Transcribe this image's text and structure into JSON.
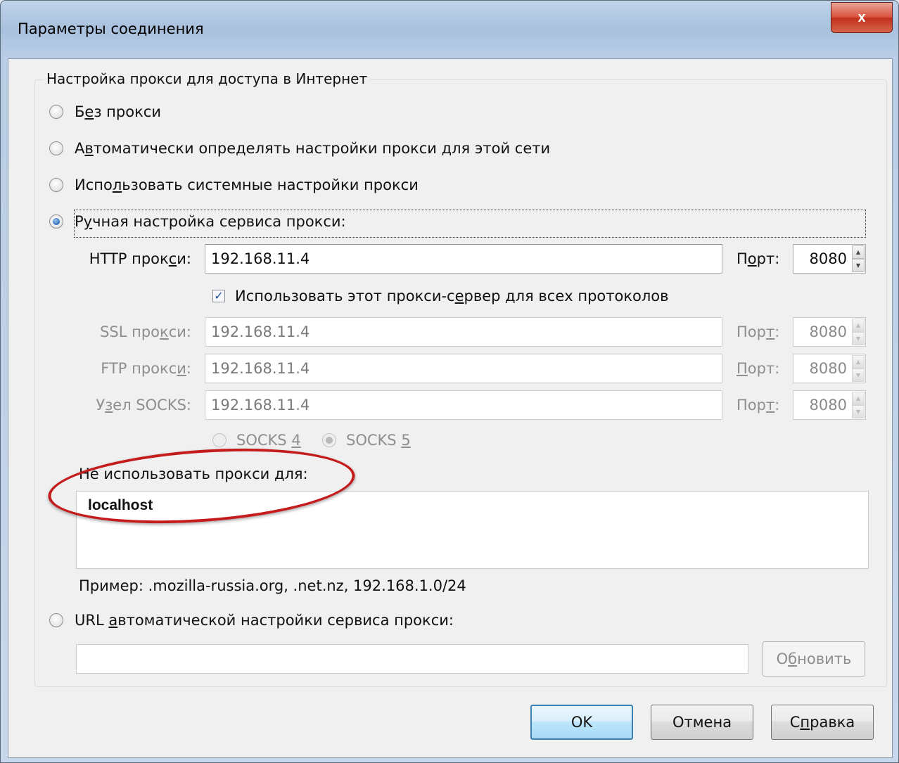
{
  "window": {
    "title": "Параметры соединения",
    "close_glyph": "x"
  },
  "proxy_group": {
    "label": "Настройка прокси для доступа в Интернет"
  },
  "options": {
    "no_proxy": {
      "pre": "Б",
      "ul": "е",
      "post": "з прокси",
      "selected": false
    },
    "auto_detect": {
      "pre": "А",
      "ul": "в",
      "post": "томатически определять настройки прокси для этой сети",
      "selected": false
    },
    "system": {
      "pre": "Испо",
      "ul": "л",
      "post": "ьзовать системные настройки прокси",
      "selected": false
    },
    "manual": {
      "pre": "Р",
      "ul": "у",
      "post": "чная настройка сервиса прокси:",
      "selected": true
    },
    "auto_url": {
      "pre": "URL ",
      "ul": "а",
      "post": "втоматической настройки сервиса прокси:",
      "selected": false
    }
  },
  "http": {
    "label_pre": "HTTP прок",
    "label_ul": "с",
    "label_post": "и:",
    "value": "192.168.11.4",
    "port_label_pre": "П",
    "port_label_ul": "о",
    "port_label_post": "рт:",
    "port": "8080"
  },
  "use_for_all": {
    "pre": "Использовать этот прокси-с",
    "ul": "е",
    "post": "рвер для всех протоколов",
    "checked": true
  },
  "ssl": {
    "label_pre": "SSL про",
    "label_ul": "к",
    "label_post": "си:",
    "value": "192.168.11.4",
    "port_label_pre": "Пор",
    "port_label_ul": "т",
    "port_label_post": ":",
    "port": "8080"
  },
  "ftp": {
    "label_pre": "FTP прокс",
    "label_ul": "и",
    "label_post": ":",
    "value": "192.168.11.4",
    "port_label_pre": "",
    "port_label_ul": "П",
    "port_label_post": "орт:",
    "port": "8080"
  },
  "socks": {
    "label_pre": "У",
    "label_ul": "з",
    "label_post": "ел SOCKS:",
    "value": "192.168.11.4",
    "port_label_pre": "Пор",
    "port_label_ul": "т",
    "port_label_post": ":",
    "port": "8080"
  },
  "socks_version": {
    "v4": {
      "pre": "SOCKS ",
      "ul": "4"
    },
    "v5": {
      "pre": "SOCKS ",
      "ul": "5"
    },
    "selected": "v5"
  },
  "no_proxy_for": {
    "label": "Не использовать прокси для:",
    "value": "localhost",
    "example": "Пример: .mozilla-russia.org, .net.nz, 192.168.1.0/24"
  },
  "auto_url_field": {
    "value": ""
  },
  "buttons": {
    "reload": {
      "pre": "О",
      "ul": "б",
      "post": "новить"
    },
    "ok": "OK",
    "cancel": "Отмена",
    "help": {
      "pre": "С",
      "ul": "п",
      "post": "равка"
    }
  },
  "colors": {
    "annotation": "#c41c1c",
    "selection_blue": "#2a6bb6"
  }
}
